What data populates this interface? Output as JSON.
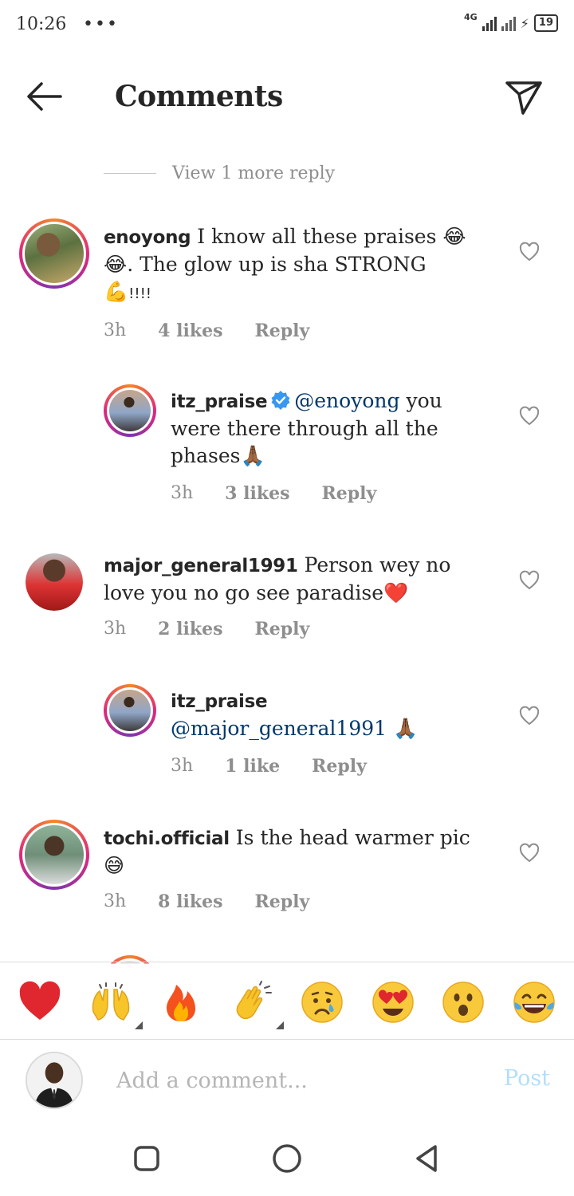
{
  "status_bar": {
    "time": "10:26",
    "dots": "•••",
    "network": "4G",
    "battery": "19"
  },
  "header": {
    "title": "Comments"
  },
  "view_more": "View 1 more reply",
  "comments": [
    {
      "username": "enoyong",
      "text_before": " I know all these praises ",
      "emoji1": "😂",
      "line2_emoji": "😂",
      "text_after": ". The glow up is sha STRONG",
      "emoji3": "💪",
      "tail": "!!!!",
      "time": "3h",
      "likes": "4 likes",
      "reply": "Reply"
    },
    {
      "username": "itz_praise",
      "mention": "@enoyong",
      "text": " you were there through all the phases",
      "emoji": "🙏🏾",
      "time": "3h",
      "likes": "3 likes",
      "reply": "Reply"
    },
    {
      "username": "major_general1991",
      "text": " Person wey no love you no go see paradise",
      "emoji": "❤️",
      "time": "3h",
      "likes": "2 likes",
      "reply": "Reply"
    },
    {
      "username": "itz_praise",
      "mention": "@major_general1991",
      "emoji": " 🙏🏾",
      "time": "3h",
      "likes": "1 like",
      "reply": "Reply"
    },
    {
      "username": "tochi.official",
      "text": " Is the head warmer pic",
      "emoji": "😅",
      "time": "3h",
      "likes": "8 likes",
      "reply": "Reply"
    }
  ],
  "reactions": [
    "❤️",
    "🙌",
    "🔥",
    "👏",
    "😢",
    "😍",
    "😮",
    "😂"
  ],
  "composer": {
    "placeholder": "Add a comment...",
    "post_label": "Post"
  },
  "colors": {
    "mention": "#00376b",
    "verified": "#3897f0",
    "post_disabled": "#b2dffc",
    "meta": "#8e8e8e"
  }
}
